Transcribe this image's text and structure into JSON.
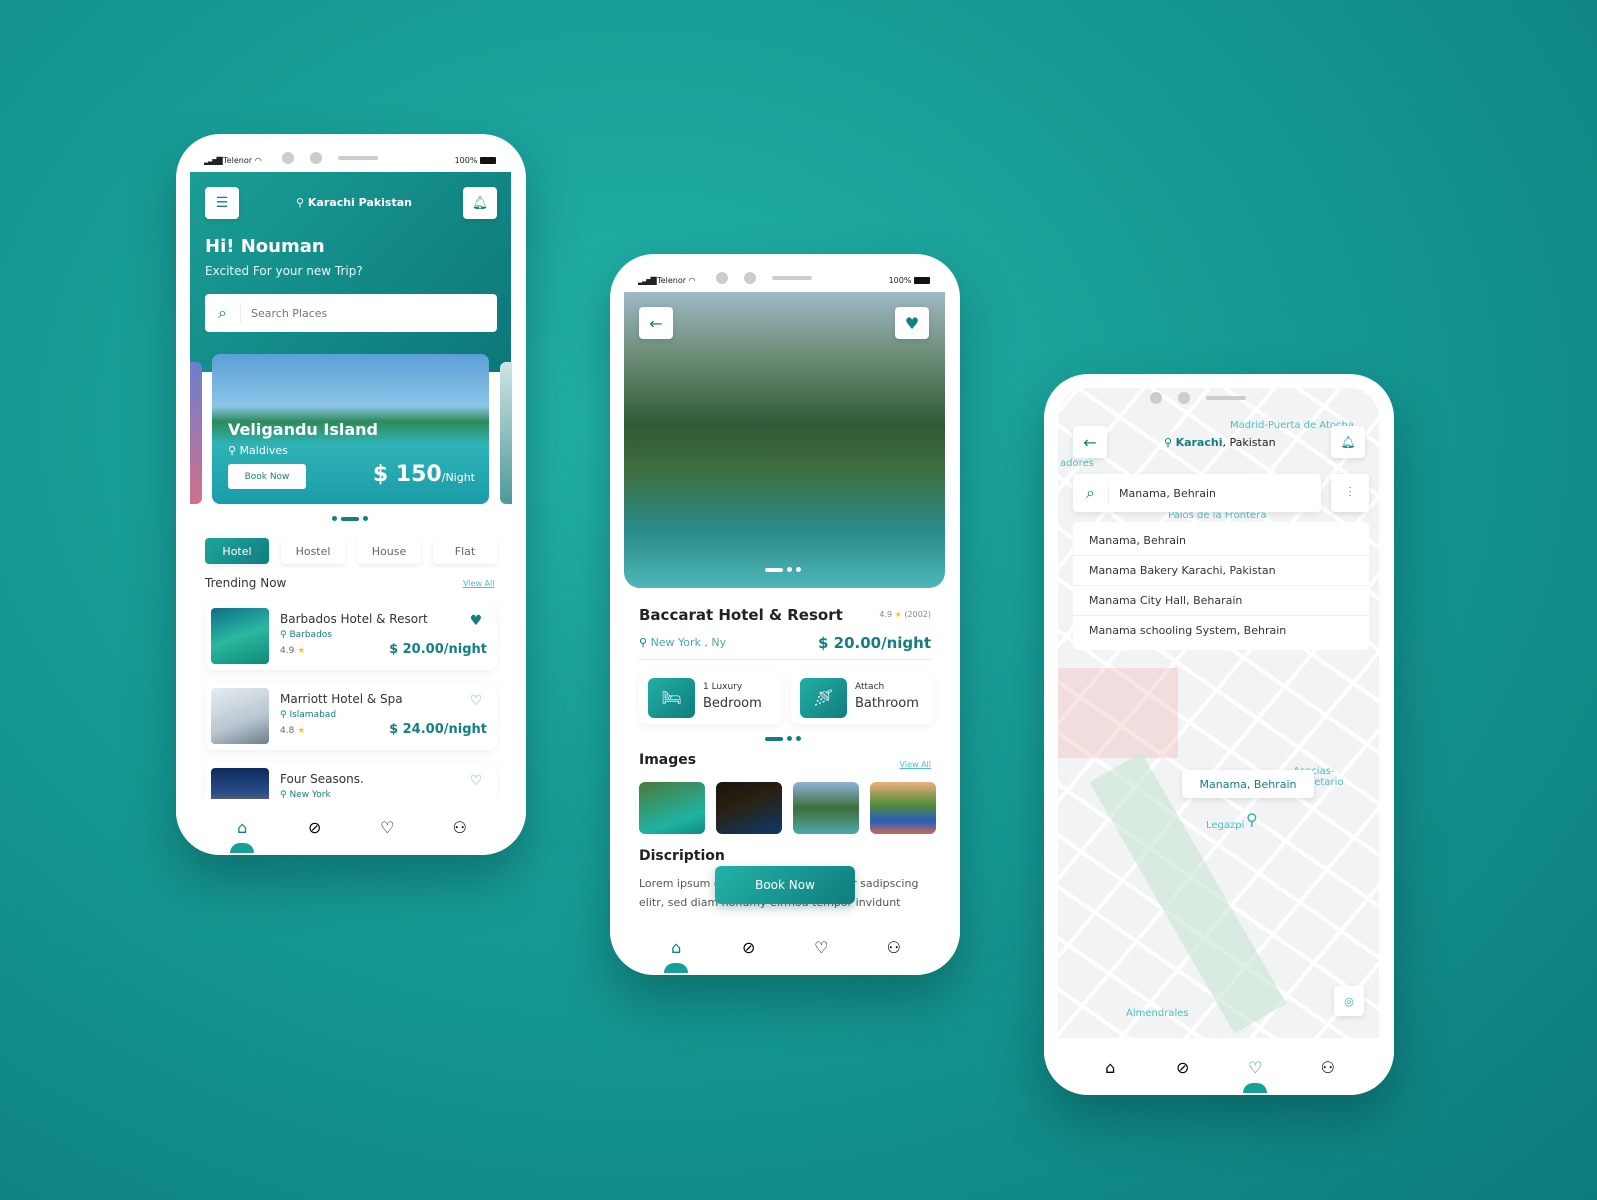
{
  "colors": {
    "accent": "#137f80",
    "accent_light": "#17a097",
    "star": "#f5c518",
    "background": "#169a95"
  },
  "status_bar": {
    "carrier": "Telenor",
    "battery": "100%"
  },
  "home": {
    "location": "Karachi  Pakistan",
    "greeting": "Hi! Nouman",
    "subtitle": "Excited For your new Trip?",
    "search_placeholder": "Search Places",
    "featured": {
      "name": "Veligandu Island",
      "location": "Maldives",
      "book_label": "Book Now",
      "price": "$ 150",
      "per": "/Night"
    },
    "tabs": [
      "Hotel",
      "Hostel",
      "House",
      "Flat"
    ],
    "active_tab": "Hotel",
    "trending_title": "Trending Now",
    "view_all": "View All",
    "hotels": [
      {
        "name": "Barbados Hotel & Resort",
        "location": "Barbados",
        "rating": "4.9",
        "price": "$ 20.00/night",
        "favorite": true
      },
      {
        "name": "Marriott Hotel & Spa",
        "location": "Islamabad",
        "rating": "4.8",
        "price": "$ 24.00/night",
        "favorite": false
      },
      {
        "name": "Four Seasons.",
        "location": "New York",
        "favorite": false
      }
    ]
  },
  "detail": {
    "name": "Baccarat Hotel & Resort",
    "rating": "4.9",
    "reviews": "(2002)",
    "location": "New York , Ny",
    "price": "$ 20.00/night",
    "amenities": [
      {
        "top": "1 Luxury",
        "bottom": "Bedroom",
        "icon": "bed-icon"
      },
      {
        "top": "Attach",
        "bottom": "Bathroom",
        "icon": "bathroom-icon"
      }
    ],
    "images_title": "Images",
    "view_all": "View All",
    "description_title": "Discription",
    "description": "Lorem ipsum dolor sit amet, consetetur sadipscing elitr, sed diam nonumy eirmod tempor invidunt labore et dolore magna aliquyam erat, sed diam",
    "book_label": "Book Now"
  },
  "map": {
    "location_bold": "Karachi",
    "location_rest": ", Pakistan",
    "search_value": "Manama, Behrain",
    "suggestions": [
      "Manama, Behrain",
      "Manama Bakery Karachi, Pakistan",
      "Manama City Hall, Beharain",
      "Manama schooling System, Behrain"
    ],
    "pin_label": "Manama, Behrain",
    "map_labels": [
      "Madrid-Puerta de Atocha",
      "adores",
      "Palos de la Frontera",
      "Legazpi",
      "Almendrales",
      "Acacias-Planetario"
    ]
  }
}
